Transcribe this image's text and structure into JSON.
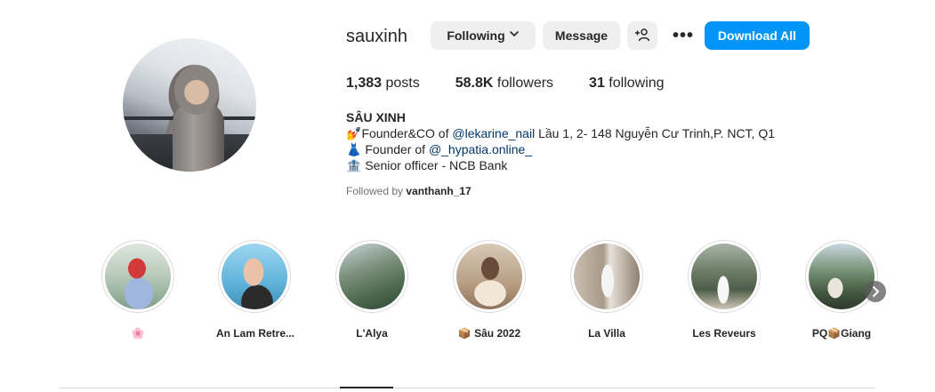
{
  "profile": {
    "username": "sauxinh",
    "stats": {
      "posts_count": "1,383",
      "posts_label": "posts",
      "followers_count": "58.8K",
      "followers_label": "followers",
      "following_count": "31",
      "following_label": "following"
    },
    "full_name": "SÂU XINH",
    "bio": [
      {
        "emoji": "💅",
        "text_before": "Founder&CO of ",
        "link": "@lekarine_nail",
        "text_after": " Lầu 1, 2- 148 Nguyễn Cư Trinh,P. NCT, Q1"
      },
      {
        "emoji": "👗",
        "text_before": " Founder of ",
        "link": "@_hypatia.online_",
        "text_after": ""
      },
      {
        "emoji": "🏦",
        "text_before": " Senior officer - NCB Bank",
        "link": "",
        "text_after": ""
      }
    ],
    "followed_by_prefix": "Followed by ",
    "followed_by_user": "vanthanh_17"
  },
  "actions": {
    "following_label": "Following",
    "message_label": "Message",
    "more_label": "•••",
    "download_label": "Download All"
  },
  "highlights": [
    {
      "label": "🌸"
    },
    {
      "label": "An Lam Retre..."
    },
    {
      "label": "L'Alya"
    },
    {
      "label": "📦 Sâu 2022"
    },
    {
      "label": "La Villa"
    },
    {
      "label": "Les Reveurs"
    },
    {
      "label": "PQ📦Giang"
    }
  ],
  "colors": {
    "accent": "#0095f6",
    "button_bg": "#efefef",
    "link": "#00376b"
  }
}
